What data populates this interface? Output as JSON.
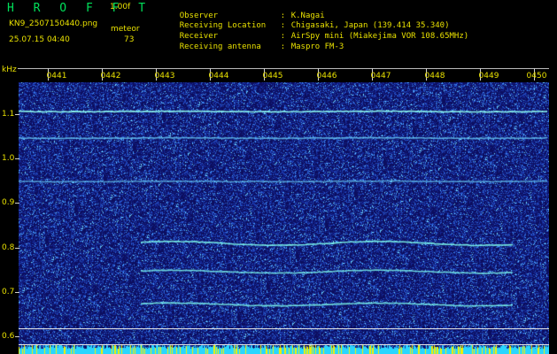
{
  "header": {
    "brand": "H R O F F T",
    "version": "1.00f",
    "filename": "KN9_2507150440.png",
    "mode": "meteor",
    "datetime": "25.07.15 04:40",
    "count": "73"
  },
  "meta": [
    {
      "label": "Observer",
      "value": "K.Nagai"
    },
    {
      "label": "Receiving Location",
      "value": "Chigasaki, Japan (139.414 35.340)"
    },
    {
      "label": "Receiver",
      "value": "AirSpy mini (Miakejima VOR 108.65MHz)"
    },
    {
      "label": "Receiving antenna",
      "value": "Maspro FM-3"
    }
  ],
  "meta_separator": ":",
  "axis": {
    "unit": "kHz",
    "time_labels": [
      "0441",
      "0442",
      "0443",
      "0444",
      "0445",
      "0446",
      "0447",
      "0448",
      "0449",
      "0450"
    ],
    "freq_labels": [
      "1.1",
      "1.0",
      "0.9",
      "0.8",
      "0.7",
      "0.6"
    ]
  },
  "colors": {
    "background": "#000000",
    "spectrogram_noise_dark": "#10106a",
    "spectrogram_noise_bright": "#4fa0ff",
    "signal_cyan": "#70fff4",
    "text_yellow": "#e8e000",
    "brand_green": "#00e05a",
    "axis_gray": "#d0d0d0"
  }
}
